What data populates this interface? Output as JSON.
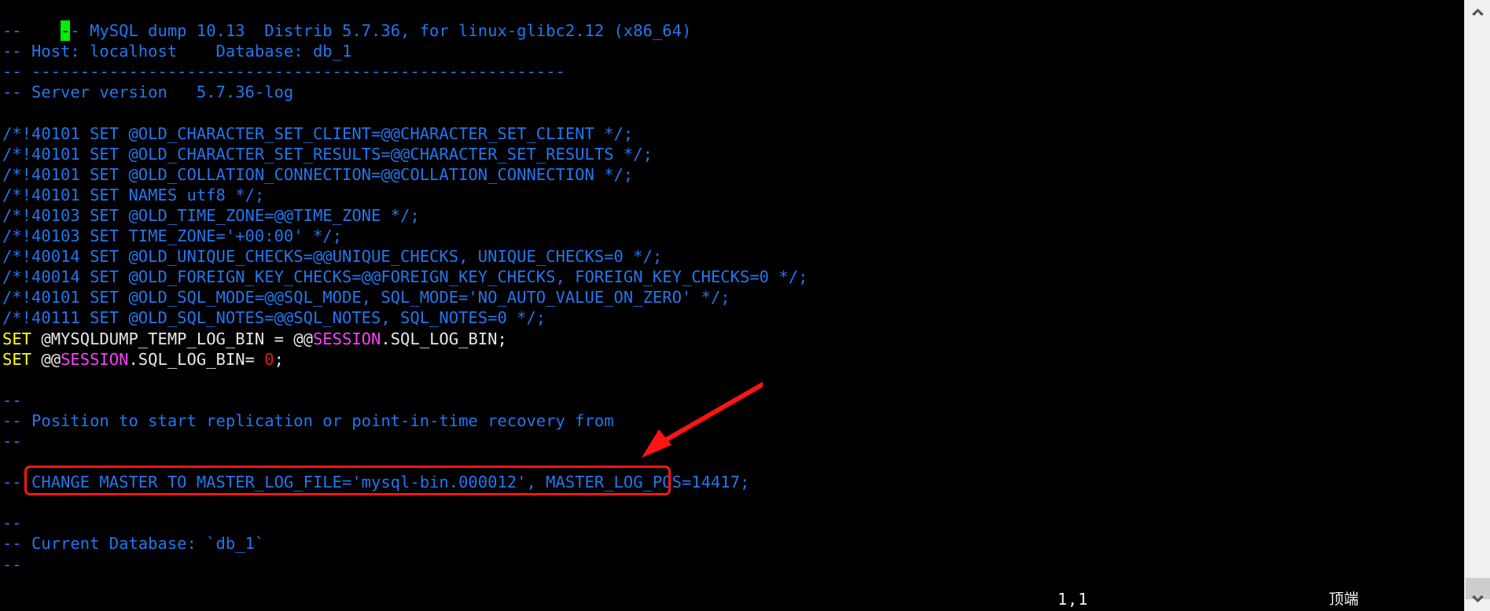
{
  "terminal": {
    "background_color": "#000000",
    "comment_color": "#2277ee",
    "keyword_color": "#ffff00",
    "plain_color": "#e8e8e8",
    "variable_color": "#ff3cff",
    "number_color": "#e01b1b",
    "cursor_color": "#00ee00",
    "lines": [
      {
        "id": "l1",
        "text": "-- MySQL dump 10.13  Distrib 5.7.36, for linux-glibc2.12 (x86_64)",
        "cursor_char": "-"
      },
      {
        "id": "l2",
        "text": "--"
      },
      {
        "id": "l3",
        "text": "-- Host: localhost    Database: db_1"
      },
      {
        "id": "l4",
        "text": "-- -------------------------------------------------------"
      },
      {
        "id": "l5",
        "text": "-- Server version\t5.7.36-log"
      },
      {
        "id": "l6",
        "text": ""
      },
      {
        "id": "l7",
        "text": "/*!40101 SET @OLD_CHARACTER_SET_CLIENT=@@CHARACTER_SET_CLIENT */;"
      },
      {
        "id": "l8",
        "text": "/*!40101 SET @OLD_CHARACTER_SET_RESULTS=@@CHARACTER_SET_RESULTS */;"
      },
      {
        "id": "l9",
        "text": "/*!40101 SET @OLD_COLLATION_CONNECTION=@@COLLATION_CONNECTION */;"
      },
      {
        "id": "l10",
        "text": "/*!40101 SET NAMES utf8 */;"
      },
      {
        "id": "l11",
        "text": "/*!40103 SET @OLD_TIME_ZONE=@@TIME_ZONE */;"
      },
      {
        "id": "l12",
        "text": "/*!40103 SET TIME_ZONE='+00:00' */;"
      },
      {
        "id": "l13",
        "text": "/*!40014 SET @OLD_UNIQUE_CHECKS=@@UNIQUE_CHECKS, UNIQUE_CHECKS=0 */;"
      },
      {
        "id": "l14",
        "text": "/*!40014 SET @OLD_FOREIGN_KEY_CHECKS=@@FOREIGN_KEY_CHECKS, FOREIGN_KEY_CHECKS=0 */;"
      },
      {
        "id": "l15",
        "text": "/*!40101 SET @OLD_SQL_MODE=@@SQL_MODE, SQL_MODE='NO_AUTO_VALUE_ON_ZERO' */;"
      },
      {
        "id": "l16",
        "text": "/*!40111 SET @OLD_SQL_NOTES=@@SQL_NOTES, SQL_NOTES=0 */;"
      },
      {
        "id": "l17",
        "text": "SET @MYSQLDUMP_TEMP_LOG_BIN = @@SESSION.SQL_LOG_BIN;"
      },
      {
        "id": "l18",
        "text": "SET @@SESSION.SQL_LOG_BIN= 0;"
      },
      {
        "id": "l19",
        "text": ""
      },
      {
        "id": "l20",
        "text": "--"
      },
      {
        "id": "l21",
        "text": "-- Position to start replication or point-in-time recovery from"
      },
      {
        "id": "l22",
        "text": "--"
      },
      {
        "id": "l23",
        "text": ""
      },
      {
        "id": "l24",
        "text": "-- CHANGE MASTER TO MASTER_LOG_FILE='mysql-bin.000012', MASTER_LOG_POS=14417;"
      },
      {
        "id": "l25",
        "text": ""
      },
      {
        "id": "l26",
        "text": "--"
      },
      {
        "id": "l27",
        "text": "-- Current Database: `db_1`"
      },
      {
        "id": "l28",
        "text": "--"
      }
    ]
  },
  "tokens": {
    "l17": [
      {
        "t": "SET",
        "c": "keyword"
      },
      {
        "t": " @MYSQLDUMP_TEMP_LOG_BIN = @@",
        "c": "plain"
      },
      {
        "t": "SESSION",
        "c": "var"
      },
      {
        "t": ".SQL_LOG_BIN;",
        "c": "plain"
      }
    ],
    "l18": [
      {
        "t": "SET",
        "c": "keyword"
      },
      {
        "t": " @@",
        "c": "plain"
      },
      {
        "t": "SESSION",
        "c": "var"
      },
      {
        "t": ".SQL_LOG_BIN= ",
        "c": "plain"
      },
      {
        "t": "0",
        "c": "number"
      },
      {
        "t": ";",
        "c": "plain"
      }
    ]
  },
  "annotations": {
    "highlight_box": {
      "label": "change-master-statement-highlight",
      "color": "#ff1414",
      "target_text": "CHANGE MASTER TO MASTER_LOG_FILE='mysql-bin.000012', MASTER_LOG_POS=14417;"
    },
    "arrow": {
      "label": "pointer-arrow-to-change-master",
      "color": "#ff1414"
    }
  },
  "statusbar": {
    "cursor_position": "1,1",
    "scroll_location": "顶端"
  },
  "scrollbar": {
    "up_arrow_icon": "chevron-up-icon",
    "down_arrow_icon": "chevron-down-icon",
    "thumb_position": "bottom"
  }
}
